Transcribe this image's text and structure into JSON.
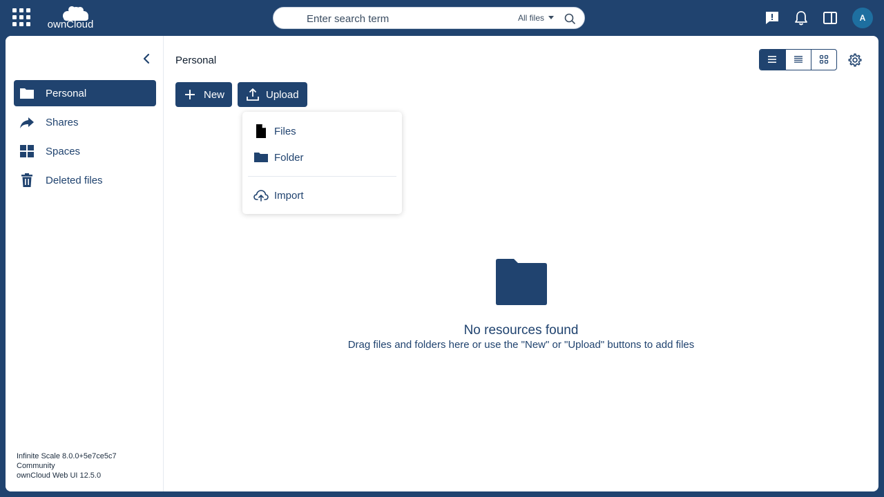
{
  "header": {
    "logo_text": "ownCloud",
    "search": {
      "placeholder": "Enter search term",
      "scope": "All files"
    }
  },
  "user": {
    "avatar_initial": "A"
  },
  "sidebar": {
    "items": [
      {
        "label": "Personal",
        "icon": "folder-icon",
        "active": true
      },
      {
        "label": "Shares",
        "icon": "share-icon",
        "active": false
      },
      {
        "label": "Spaces",
        "icon": "grid-icon",
        "active": false
      },
      {
        "label": "Deleted files",
        "icon": "trash-icon",
        "active": false
      }
    ],
    "version_lines": [
      "Infinite Scale 8.0.0+5e7ce5c7",
      "Community",
      "ownCloud Web UI 12.5.0"
    ]
  },
  "main": {
    "breadcrumb": "Personal",
    "new_button": "New",
    "upload_button": "Upload",
    "upload_menu": [
      {
        "label": "Files",
        "icon": "file-icon"
      },
      {
        "label": "Folder",
        "icon": "folder-icon"
      },
      {
        "label": "Import",
        "icon": "cloud-upload-icon"
      }
    ],
    "empty": {
      "title": "No resources found",
      "subtitle": "Drag files and folders here or use the \"New\" or \"Upload\" buttons to add files"
    }
  },
  "colors": {
    "brand": "#20436f",
    "avatar": "#1e6fa0"
  }
}
